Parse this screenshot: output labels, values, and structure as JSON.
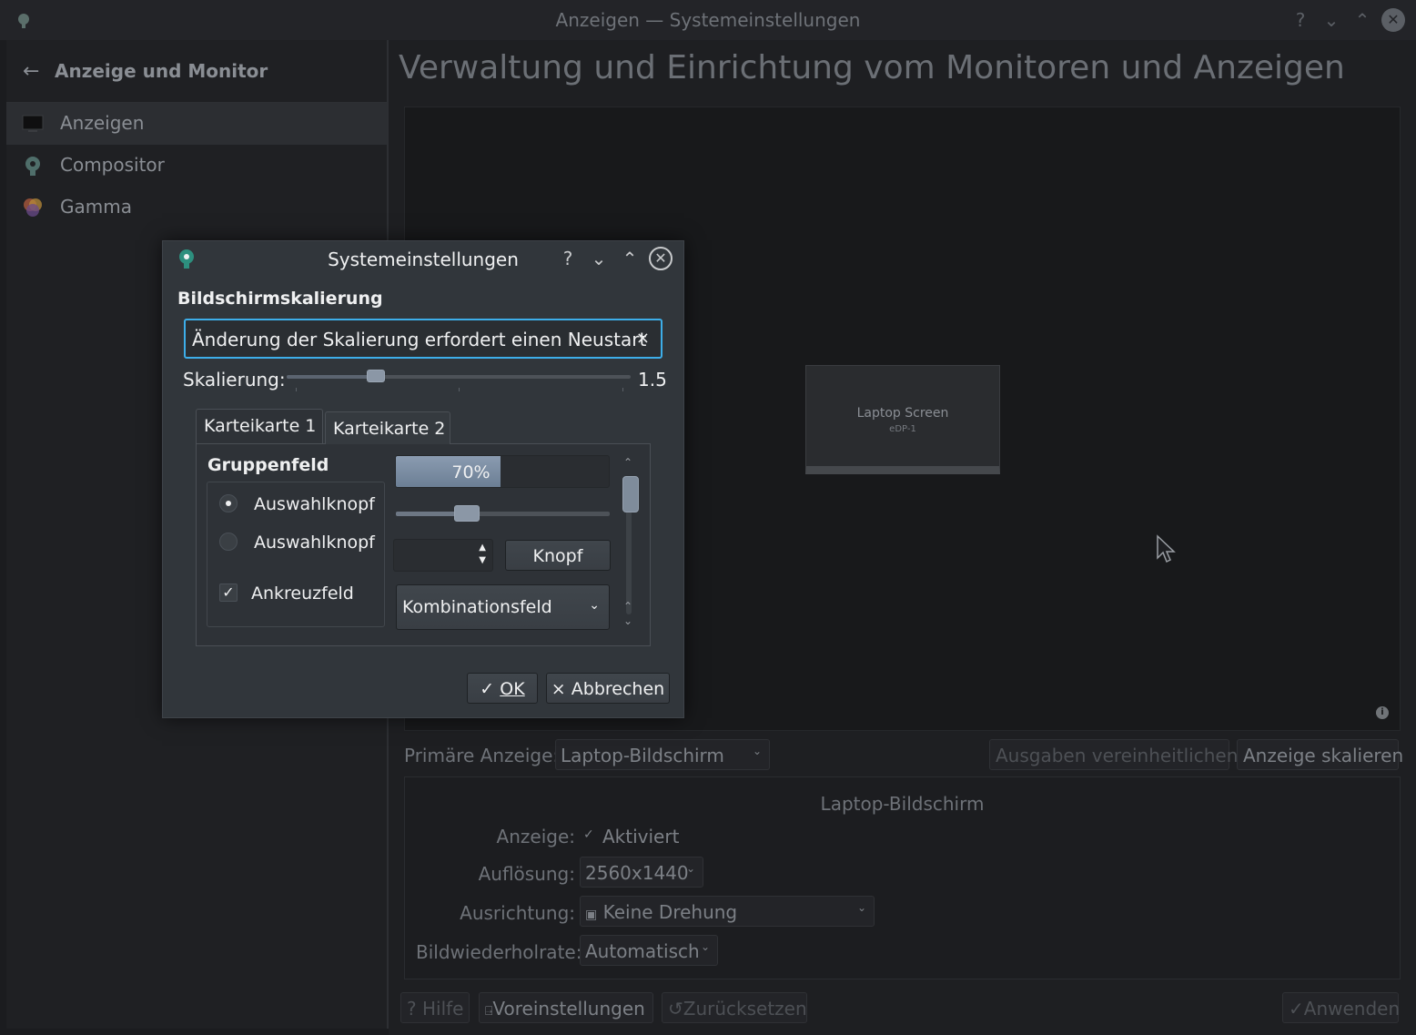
{
  "window": {
    "title": "Anzeigen — Systemeinstellungen",
    "ctrl_help": "?",
    "ctrl_min": "⌄",
    "ctrl_max": "⌃",
    "ctrl_close": "✕"
  },
  "sidebar": {
    "header": "Anzeige und Monitor",
    "items": [
      {
        "label": "Anzeigen",
        "icon": "monitor-icon",
        "active": true
      },
      {
        "label": "Compositor",
        "icon": "compositor-icon",
        "active": false
      },
      {
        "label": "Gamma",
        "icon": "gamma-icon",
        "active": false
      }
    ]
  },
  "main": {
    "title": "Verwaltung und Einrichtung vom Monitoren und Anzeigen",
    "screen_name": "Laptop Screen",
    "screen_connector": "eDP-1",
    "info": "i",
    "primary_label": "Primäre Anzeige:",
    "primary_value": "Laptop-Bildschirm",
    "unify_button": "Ausgaben vereinheitlichen",
    "scale_button": "Anzeige skalieren",
    "output": {
      "title": "Laptop-Bildschirm",
      "display_label": "Anzeige:",
      "display_check": "✓",
      "display_value": "Aktiviert",
      "resolution_label": "Auflösung:",
      "resolution_value": "2560x1440",
      "orientation_label": "Ausrichtung:",
      "orientation_value": "Keine Drehung",
      "refresh_label": "Bildwiederholrate:",
      "refresh_value": "Automatisch"
    },
    "bottom": {
      "help": "Hilfe",
      "defaults": "Voreinstellungen",
      "reset": "Zurücksetzen",
      "apply": "Anwenden"
    }
  },
  "dialog": {
    "title": "Systemeinstellungen",
    "section": "Bildschirmskalierung",
    "message": "Änderung der Skalierung erfordert einen Neustart",
    "message_close": "×",
    "scale_label": "Skalierung:",
    "scale_value": "1.5",
    "scale_fraction": 0.26,
    "tabs": [
      "Karteikarte 1",
      "Karteikarte 2"
    ],
    "group_title": "Gruppenfeld",
    "radio1": "Auswahlknopf",
    "radio2": "Auswahlknopf",
    "checkbox": "Ankreuzfeld",
    "checkbox_mark": "✓",
    "progress_text": "70%",
    "progress_value": 0.7,
    "slider_fraction": 0.33,
    "button": "Knopf",
    "combo": "Kombinationsfeld",
    "ok": "OK",
    "cancel": "Abbrechen"
  },
  "colors": {
    "accent": "#3daee9",
    "dialog_bg": "#31363b",
    "text": "#eff0f1"
  }
}
